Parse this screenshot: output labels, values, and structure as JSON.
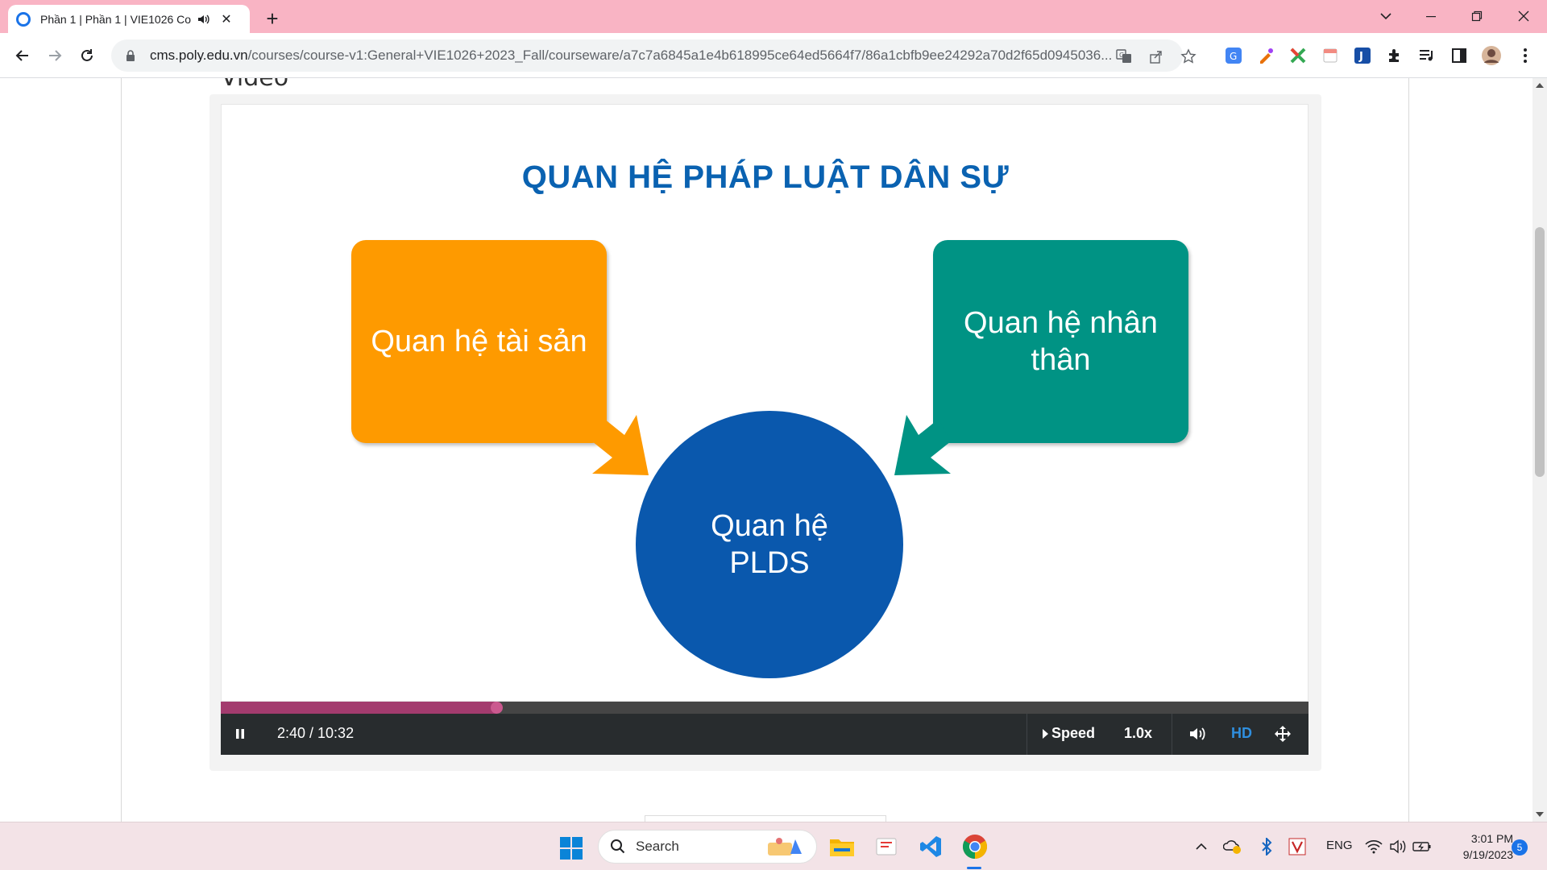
{
  "browser": {
    "tab_title": "Phần 1 | Phần 1 | VIE1026 Co",
    "url_host": "cms.poly.edu.vn",
    "url_path": "/courses/course-v1:General+VIE1026+2023_Fall/courseware/a7c7a6845a1e4b618995ce64ed5664f7/86a1cbfb9ee24292a70d2f65d0945036..."
  },
  "page": {
    "section_heading": "Video"
  },
  "slide": {
    "title": "QUAN HỆ PHÁP LUẬT DÂN SỰ",
    "box_left": "Quan hệ tài sản",
    "box_right": "Quan hệ nhân thân",
    "circle": "Quan hệ PLDS",
    "colors": {
      "title": "#0a62b1",
      "orange": "#fe9a00",
      "teal": "#009384",
      "circle": "#0a58ad"
    }
  },
  "player": {
    "time": "2:40 / 10:32",
    "progress_fraction": 0.253,
    "speed_label": "Speed",
    "speed_value": "1.0x",
    "hd_label": "HD"
  },
  "taskbar": {
    "search_placeholder": "Search",
    "lang": "ENG",
    "time": "3:01 PM",
    "date": "9/19/2023",
    "notifications": "5"
  }
}
